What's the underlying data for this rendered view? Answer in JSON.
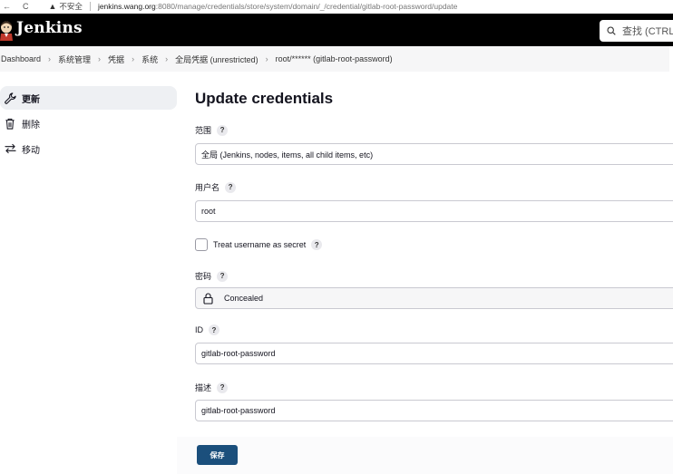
{
  "browser": {
    "nav_back": "←",
    "nav_reload": "C",
    "security_label": "不安全",
    "url_host": "jenkins.wang.org",
    "url_path": ":8080/manage/credentials/store/system/domain/_/credential/gitlab-root-password/update"
  },
  "header": {
    "app_name": "Jenkins",
    "search_placeholder": "查找 (CTRL+K)"
  },
  "breadcrumb": [
    "Dashboard",
    "系统管理",
    "凭据",
    "系统",
    "全局凭据 (unrestricted)",
    "root/****** (gitlab-root-password)"
  ],
  "sidebar": {
    "items": [
      {
        "label": "更新",
        "icon": "wrench-icon"
      },
      {
        "label": "删除",
        "icon": "trash-icon"
      },
      {
        "label": "移动",
        "icon": "move-arrows-icon"
      }
    ]
  },
  "form": {
    "title": "Update credentials",
    "scope_label": "范围",
    "scope_value": "全局 (Jenkins, nodes, items, all child items, etc)",
    "username_label": "用户名",
    "username_value": "root",
    "secret_checkbox_label": "Treat username as secret",
    "password_label": "密码",
    "password_value": "Concealed",
    "id_label": "ID",
    "id_value": "gitlab-root-password",
    "description_label": "描述",
    "description_value": "gitlab-root-password",
    "help_glyph": "?",
    "save_label": "保存"
  },
  "colors": {
    "header_bg": "#000000",
    "save_button": "#1b4f7c",
    "sidebar_active": "#eef0f3"
  }
}
